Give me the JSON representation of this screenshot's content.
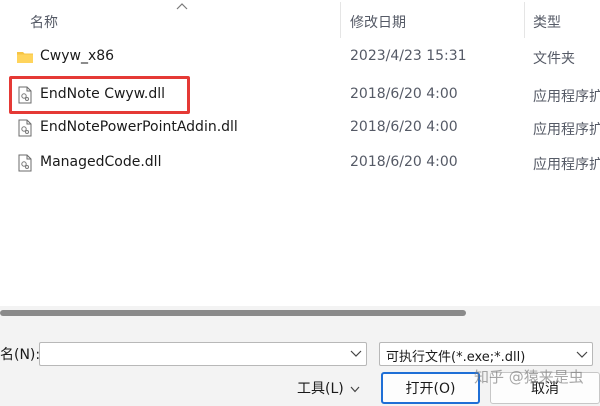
{
  "columns": {
    "name": "名称",
    "modified": "修改日期",
    "type": "类型"
  },
  "files": [
    {
      "name": "Cwyw_x86",
      "modified": "2023/4/23 15:31",
      "type": "文件夹",
      "icon": "folder-icon"
    },
    {
      "name": "EndNote Cwyw.dll",
      "modified": "2018/6/20 4:00",
      "type": "应用程序扩展",
      "icon": "dll-file-icon"
    },
    {
      "name": "EndNotePowerPointAddin.dll",
      "modified": "2018/6/20 4:00",
      "type": "应用程序扩展",
      "icon": "dll-file-icon"
    },
    {
      "name": "ManagedCode.dll",
      "modified": "2018/6/20 4:00",
      "type": "应用程序扩展",
      "icon": "dll-file-icon"
    }
  ],
  "footer": {
    "filename_label": "名(N):",
    "filename_value": "",
    "filter_selected": "可执行文件(*.exe;*.dll)",
    "tools_label": "工具(L)",
    "open_label": "打开(O)",
    "cancel_label": "取消"
  },
  "watermark": "知乎 @猿来是虫",
  "colors": {
    "highlight": "#e53935",
    "accent": "#1f6fd6",
    "folder": "#f6c444"
  }
}
